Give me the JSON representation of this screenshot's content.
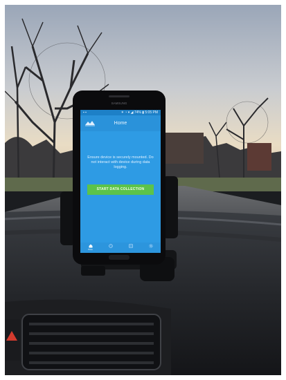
{
  "status_bar": {
    "left": "▪ ▪",
    "right": "✶ ◔ ▾ ◢ 74% ▮ 5:05 PM"
  },
  "app": {
    "title": "Home",
    "message": "Ensure device is securely mounted. Do not interact with device during data logging.",
    "button_label": "START DATA COLLECTION",
    "colors": {
      "primary": "#2e9be4",
      "accent": "#5cc34a"
    }
  },
  "nav": [
    {
      "label": "Home",
      "icon": "home-icon"
    },
    {
      "label": "",
      "icon": "clock-icon"
    },
    {
      "label": "",
      "icon": "list-icon"
    },
    {
      "label": "",
      "icon": "settings-icon"
    }
  ],
  "phone": {
    "brand": "SAMSUNG"
  }
}
